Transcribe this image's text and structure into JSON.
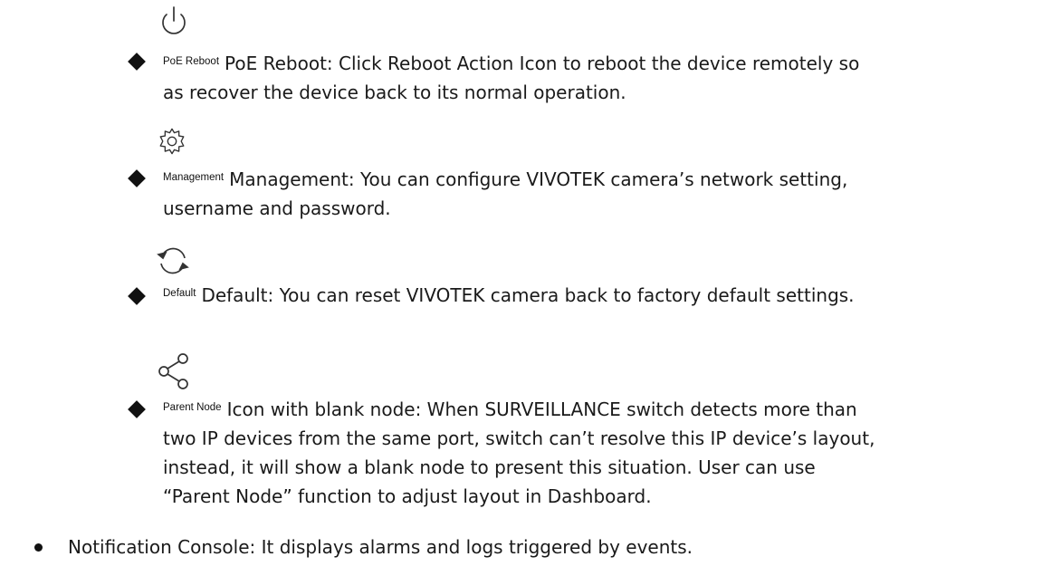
{
  "items": [
    {
      "icon": "power-icon",
      "label": "PoE Reboot",
      "text": "PoE Reboot: Click Reboot Action Icon to reboot the device remotely so as recover the device back to its normal operation."
    },
    {
      "icon": "gear-icon",
      "label": "Management",
      "text": "Management: You can configure VIVOTEK camera’s network setting, username and password."
    },
    {
      "icon": "refresh-icon",
      "label": "Default",
      "text": "Default: You can reset VIVOTEK camera back to factory default settings."
    },
    {
      "icon": "share-nodes-icon",
      "label": "Parent Node",
      "text": "Icon with blank node: When SURVEILLANCE switch detects more than two IP devices from the same port, switch can’t resolve this IP device’s layout, instead, it will show a blank node to present this situation. User can use “Parent Node” function to adjust layout in Dashboard."
    }
  ],
  "notification": {
    "text": "Notification Console: It displays alarms and logs triggered by events."
  }
}
